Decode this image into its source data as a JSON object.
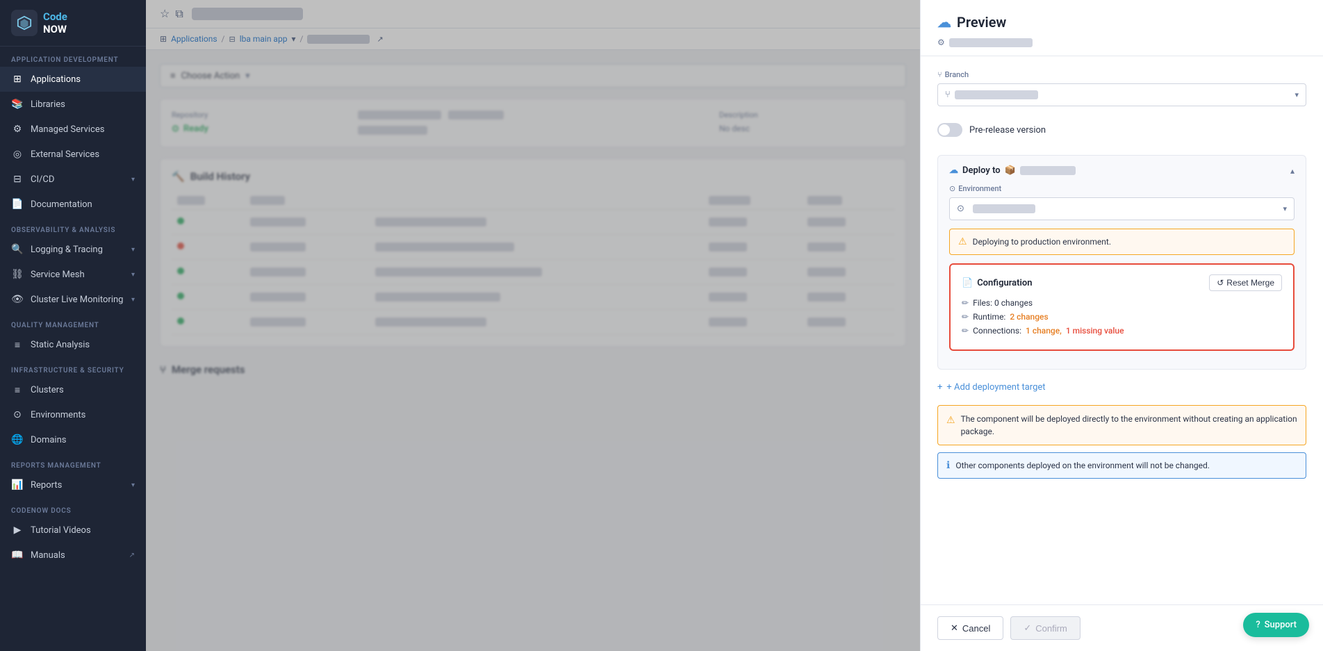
{
  "sidebar": {
    "logo": {
      "name_line1": "Code",
      "name_line2": "NOW"
    },
    "sections": [
      {
        "label": "Application Development",
        "items": [
          {
            "id": "applications",
            "label": "Applications",
            "icon": "⊞",
            "active": true
          },
          {
            "id": "libraries",
            "label": "Libraries",
            "icon": "📚",
            "active": false
          },
          {
            "id": "managed-services",
            "label": "Managed Services",
            "icon": "⚙",
            "active": false
          },
          {
            "id": "external-services",
            "label": "External Services",
            "icon": "◎",
            "active": false
          },
          {
            "id": "cicd",
            "label": "CI/CD",
            "icon": "⊟",
            "active": false,
            "has_chevron": true
          },
          {
            "id": "documentation",
            "label": "Documentation",
            "icon": "📄",
            "active": false
          }
        ]
      },
      {
        "label": "Observability & Analysis",
        "items": [
          {
            "id": "logging-tracing",
            "label": "Logging & Tracing",
            "icon": "🔍",
            "active": false,
            "has_chevron": true
          },
          {
            "id": "service-mesh",
            "label": "Service Mesh",
            "icon": "⛓",
            "active": false,
            "has_chevron": true
          },
          {
            "id": "cluster-live-monitoring",
            "label": "Cluster Live Monitoring",
            "icon": "👁",
            "active": false,
            "has_chevron": true
          }
        ]
      },
      {
        "label": "Quality Management",
        "items": [
          {
            "id": "static-analysis",
            "label": "Static Analysis",
            "icon": "≡",
            "active": false
          }
        ]
      },
      {
        "label": "Infrastructure & Security",
        "items": [
          {
            "id": "clusters",
            "label": "Clusters",
            "icon": "≡",
            "active": false
          },
          {
            "id": "environments",
            "label": "Environments",
            "icon": "⊙",
            "active": false
          },
          {
            "id": "domains",
            "label": "Domains",
            "icon": "🌐",
            "active": false
          }
        ]
      },
      {
        "label": "Reports Management",
        "items": [
          {
            "id": "reports",
            "label": "Reports",
            "icon": "📊",
            "active": false,
            "has_chevron": true
          }
        ]
      },
      {
        "label": "CodeNOW Docs",
        "items": [
          {
            "id": "tutorial-videos",
            "label": "Tutorial Videos",
            "icon": "▶",
            "active": false
          },
          {
            "id": "manuals",
            "label": "Manuals",
            "icon": "📖",
            "active": false,
            "has_ext": true
          }
        ]
      }
    ]
  },
  "topbar": {
    "title_blur_width": "160"
  },
  "breadcrumb": {
    "items": [
      "Applications",
      "/",
      "lba main app",
      "▾",
      "/"
    ],
    "blur_width": "90"
  },
  "main": {
    "action_btn": "Choose Action",
    "repository_label": "Repository",
    "status": "Ready",
    "desc_label": "Description",
    "no_desc": "No desc",
    "build_history_title": "Build History",
    "table_headers": [
      "",
      "",
      "",
      "",
      ""
    ],
    "merge_requests_title": "Merge requests"
  },
  "panel": {
    "title": "Preview",
    "cloud_icon": "☁",
    "settings_icon": "⚙",
    "branch_label": "Branch",
    "git_icon": "⑂",
    "pre_release_label": "Pre-release version",
    "deploy_to_label": "Deploy to",
    "environment_label": "Environment",
    "warning_msg": "Deploying to production environment.",
    "configuration_label": "Configuration",
    "reset_merge_label": "Reset Merge",
    "files_label": "Files: 0 changes",
    "runtime_label": "Runtime:",
    "runtime_changes": "2 changes",
    "connections_label": "Connections:",
    "connections_change": "1 change,",
    "connections_missing": "1 missing value",
    "add_deploy_label": "+ Add deployment target",
    "info_warning": "The component will be deployed directly to the environment without creating an application package.",
    "info_blue": "Other components deployed on the environment will not be changed.",
    "cancel_label": "Cancel",
    "confirm_label": "Confirm",
    "support_label": "Support",
    "info_circle_icon": "ℹ"
  }
}
